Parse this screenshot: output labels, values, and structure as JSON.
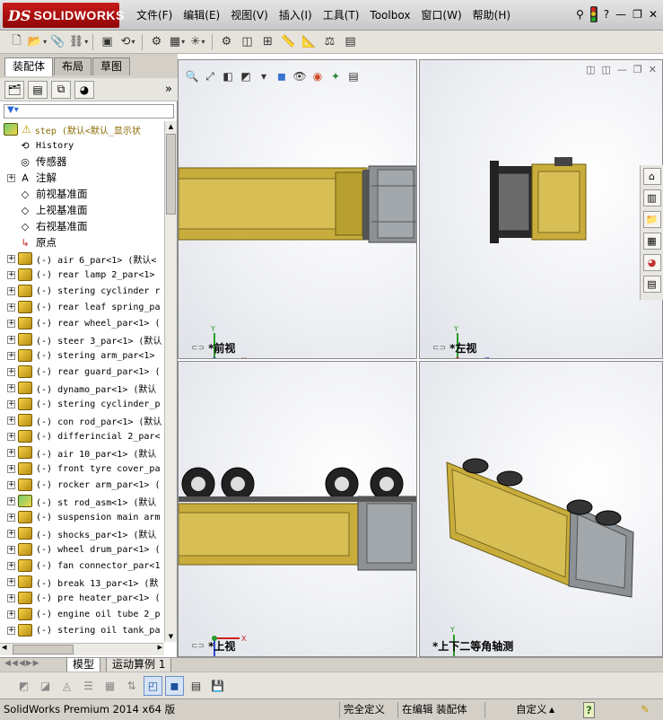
{
  "app": {
    "brand_ds": "DS",
    "brand_name": "SOLIDWORKS"
  },
  "menu": [
    "文件(F)",
    "编辑(E)",
    "视图(V)",
    "插入(I)",
    "工具(T)",
    "Toolbox",
    "窗口(W)",
    "帮助(H)"
  ],
  "window_controls": {
    "help": "?",
    "minimize": "—",
    "restore": "❐",
    "close": "✕"
  },
  "panel_tabs": [
    "装配体",
    "布局",
    "草图"
  ],
  "tree": {
    "root": "step  (默认<默认_显示状",
    "system_items": [
      {
        "label": "History",
        "icon": "history-icon"
      },
      {
        "label": "传感器",
        "icon": "sensor-icon"
      },
      {
        "label": "注解",
        "icon": "annotation-icon"
      },
      {
        "label": "前视基准面",
        "icon": "plane-icon"
      },
      {
        "label": "上视基准面",
        "icon": "plane-icon"
      },
      {
        "label": "右视基准面",
        "icon": "plane-icon"
      },
      {
        "label": "原点",
        "icon": "origin-icon"
      }
    ],
    "components": [
      "(-) air 6_par<1> (默认<",
      "(-) rear lamp 2_par<1>",
      "(-) stering cyclinder r",
      "(-) rear leaf spring_pa",
      "(-) rear wheel_par<1> (",
      "(-) steer 3_par<1> (默认",
      "(-) stering arm_par<1>",
      "(-) rear guard_par<1> (",
      "(-) dynamo_par<1> (默认",
      "(-) stering cyclinder_p",
      "(-) con rod_par<1> (默认",
      "(-) differincial 2_par<",
      "(-) air 10_par<1> (默认",
      "(-) front tyre cover_pa",
      "(-) rocker arm_par<1> (",
      "(-) st rod_asm<1> (默认",
      "(-) suspension main arm",
      "(-) shocks_par<1> (默认",
      "(-) wheel drum_par<1> (",
      "(-) fan connector_par<1",
      "(-) break 13_par<1> (默",
      "(-) pre heater_par<1> (",
      "(-) engine oil tube 2_p",
      "(-) stering oil tank_pa"
    ]
  },
  "viewports": [
    {
      "label": "*前视",
      "axes": [
        "Y",
        "X"
      ]
    },
    {
      "label": "*左视",
      "axes": [
        "Y",
        "Z"
      ]
    },
    {
      "label": "*上视",
      "axes": [
        "X",
        "Z"
      ]
    },
    {
      "label": "*上下二等角轴测",
      "axes": [
        "Y",
        "X",
        "Z"
      ]
    }
  ],
  "sheet_tabs": [
    "模型",
    "运动算例 1"
  ],
  "status": {
    "product": "SolidWorks Premium 2014 x64 版",
    "definition": "完全定义",
    "editing": "在编辑 装配体",
    "units": "自定义",
    "help": "?"
  },
  "colors": {
    "truck_body": "#c9ad3c",
    "truck_cab": "#8c9196",
    "selection": "#d6e3f7",
    "brand_red": "#b01010"
  }
}
